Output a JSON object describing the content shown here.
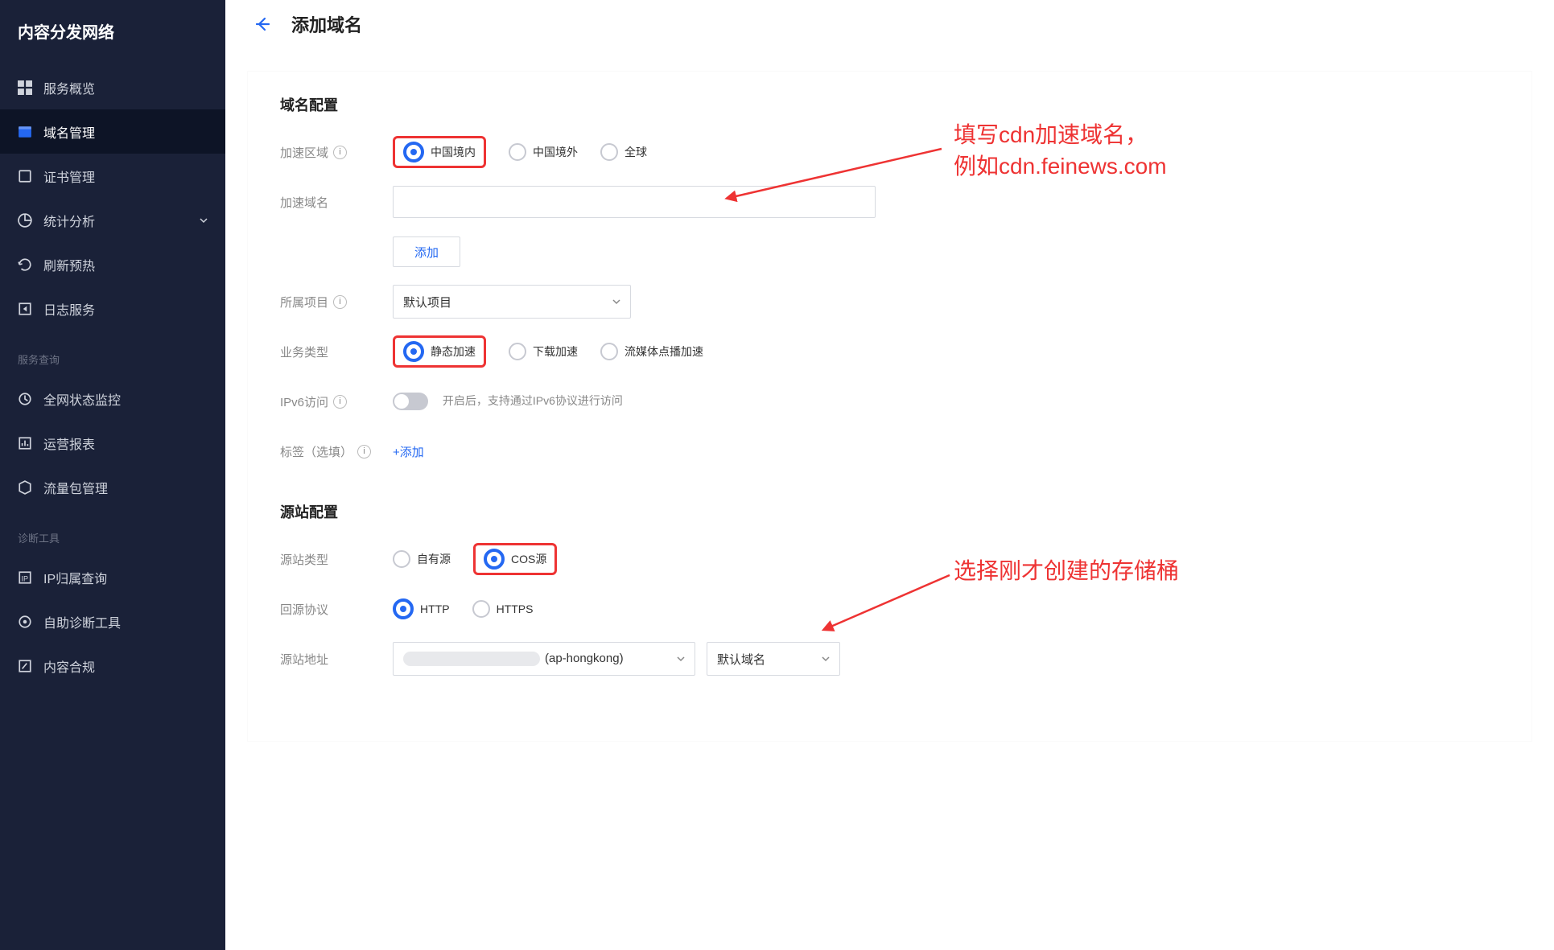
{
  "sidebar": {
    "title": "内容分发网络",
    "items": [
      {
        "label": "服务概览",
        "icon": "dashboard"
      },
      {
        "label": "域名管理",
        "icon": "globe",
        "active": true
      },
      {
        "label": "证书管理",
        "icon": "cert"
      },
      {
        "label": "统计分析",
        "icon": "stats",
        "chev": true
      },
      {
        "label": "刷新预热",
        "icon": "refresh"
      },
      {
        "label": "日志服务",
        "icon": "log"
      }
    ],
    "section2_title": "服务查询",
    "section2_items": [
      {
        "label": "全网状态监控",
        "icon": "monitor"
      },
      {
        "label": "运营报表",
        "icon": "report"
      },
      {
        "label": "流量包管理",
        "icon": "package"
      }
    ],
    "section3_title": "诊断工具",
    "section3_items": [
      {
        "label": "IP归属查询",
        "icon": "ip"
      },
      {
        "label": "自助诊断工具",
        "icon": "diag"
      },
      {
        "label": "内容合规",
        "icon": "compliance"
      }
    ]
  },
  "header": {
    "page_title": "添加域名"
  },
  "section1": {
    "title": "域名配置",
    "row_region_label": "加速区域",
    "region_options": [
      "中国境内",
      "中国境外",
      "全球"
    ],
    "region_selected_index": 0,
    "row_domain_label": "加速域名",
    "domain_value": "",
    "add_btn": "添加",
    "row_project_label": "所属项目",
    "project_value": "默认项目",
    "row_biztype_label": "业务类型",
    "biztype_options": [
      "静态加速",
      "下载加速",
      "流媒体点播加速"
    ],
    "biztype_selected_index": 0,
    "row_ipv6_label": "IPv6访问",
    "ipv6_desc": "开启后，支持通过IPv6协议进行访问",
    "row_tag_label": "标签（选填）",
    "tag_add": "+添加"
  },
  "section2": {
    "title": "源站配置",
    "row_type_label": "源站类型",
    "type_options": [
      "自有源",
      "COS源"
    ],
    "type_selected_index": 1,
    "row_proto_label": "回源协议",
    "proto_options": [
      "HTTP",
      "HTTPS"
    ],
    "proto_selected_index": 0,
    "row_addr_label": "源站地址",
    "addr_suffix": "(ap-hongkong)",
    "addr_right": "默认域名"
  },
  "annotations": {
    "note1_line1": "填写cdn加速域名，",
    "note1_line2": "例如cdn.feinews.com",
    "note2": "选择刚才创建的存储桶"
  }
}
